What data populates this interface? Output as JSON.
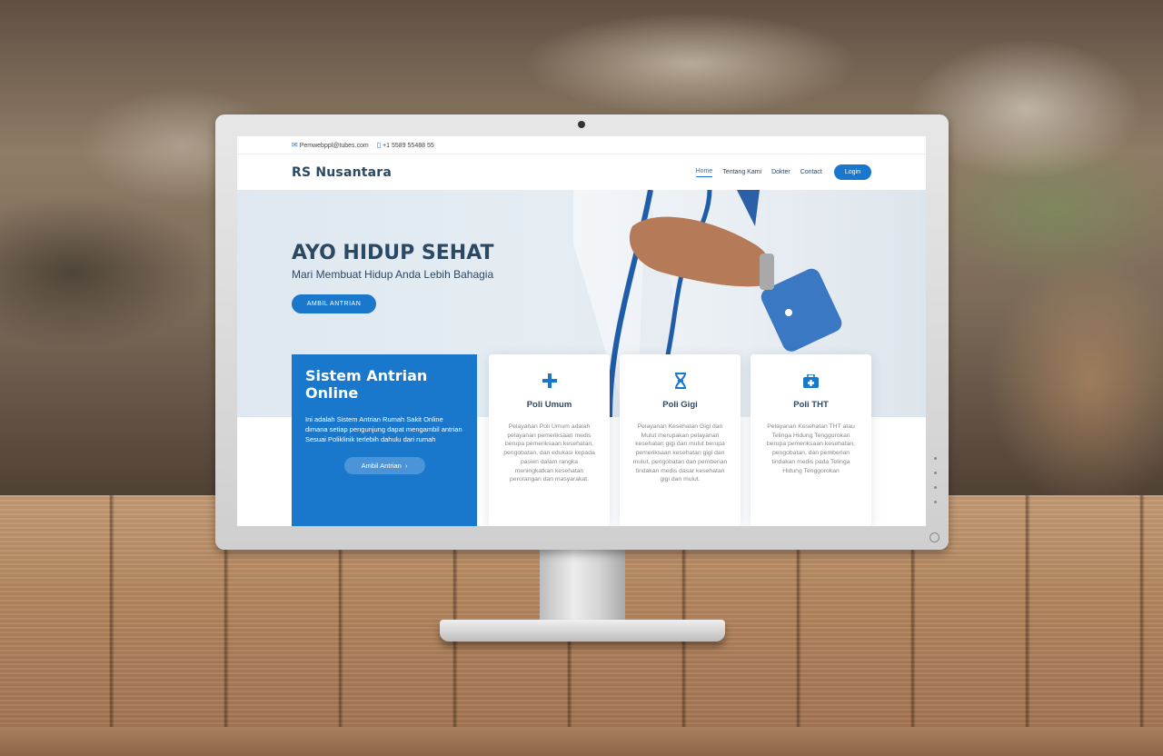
{
  "topbar": {
    "email": "Pemwebppl@tubes.com",
    "phone": "+1 5589 55488 55",
    "email_icon": "envelope-icon",
    "phone_icon": "phone-icon"
  },
  "navbar": {
    "logo": "RS Nusantara",
    "items": [
      "Home",
      "Tentang Kami",
      "Dokter",
      "Contact"
    ],
    "active_item": "Home",
    "login_label": "Login"
  },
  "hero": {
    "title": "AYO HIDUP SEHAT",
    "subtitle": "Mari Membuat Hidup Anda Lebih Bahagia",
    "cta_label": "AMBIL ANTRIAN"
  },
  "intro": {
    "title": "Sistem Antrian Online",
    "description": "Ini adalah Sistem Antrian Rumah Sakit Online dimana setiap pengunjung dapat mengambil antrian Sesuai Poliklinik terlebih dahulu dari rumah",
    "button_label": "Ambil Antrian",
    "button_icon": "chevron-right-icon"
  },
  "services": [
    {
      "title": "Poli Umum",
      "icon": "plus-icon",
      "description": "Pelayanan Poli Umum adalah pelayanan pemeriksaan medis berupa pemeriksaan kesehatan, pengobatan, dan edukasi kepada pasien dalam rangka meningkatkan kesehatan perorangan dan masyarakat."
    },
    {
      "title": "Poli Gigi",
      "icon": "dna-icon",
      "description": "Pelayanan Kesehatan Gigi dan Mulut merupakan pelayanan kesehatan gigi dan mulut berupa pemeriksaan kesehatan gigi dan mulut, pengobatan dan pemberian tindakan medis dasar kesehatan gigi dan mulut."
    },
    {
      "title": "Poli THT",
      "icon": "medical-kit-icon",
      "description": "Pelayanan Kesehatan THT atau Telinga Hidung Tenggorokan berupa pemeriksaan kesehatan, pengobatan, dan pemberian tindakan medis pada Telinga Hidung Tenggorokan"
    }
  ],
  "colors": {
    "primary": "#1977cc",
    "heading": "#2c4964"
  }
}
